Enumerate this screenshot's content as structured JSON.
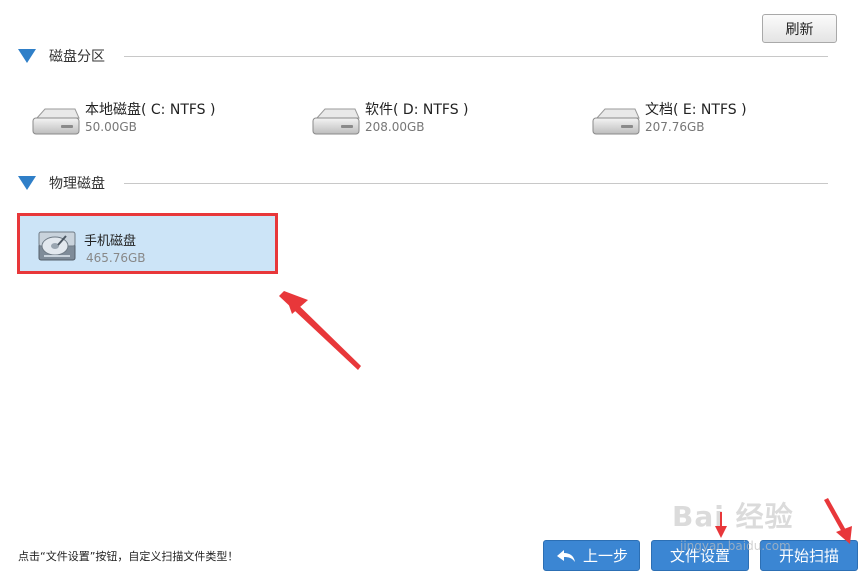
{
  "toolbar": {
    "refresh_label": "刷新"
  },
  "sections": {
    "partitions": {
      "title": "磁盘分区"
    },
    "physical": {
      "title": "物理磁盘"
    }
  },
  "partitions": [
    {
      "name": "本地磁盘( C: NTFS )",
      "size": "50.00GB"
    },
    {
      "name": "软件( D: NTFS )",
      "size": "208.00GB"
    },
    {
      "name": "文档( E: NTFS )",
      "size": "207.76GB"
    }
  ],
  "physical_disks": [
    {
      "name": "手机磁盘",
      "size": "465.76GB"
    }
  ],
  "footer": {
    "hint": "点击“文件设置”按钮，自定义扫描文件类型！",
    "back_label": "上一步",
    "file_settings_label": "文件设置",
    "start_scan_label": "开始扫描"
  },
  "colors": {
    "accent": "#3b86d3",
    "triangle": "#2f7fc8",
    "selection": "#cce4f7",
    "annotation": "#e8373a"
  },
  "watermark": {
    "text": "Bai 经验",
    "sub": "jingyan.baidu.com"
  }
}
